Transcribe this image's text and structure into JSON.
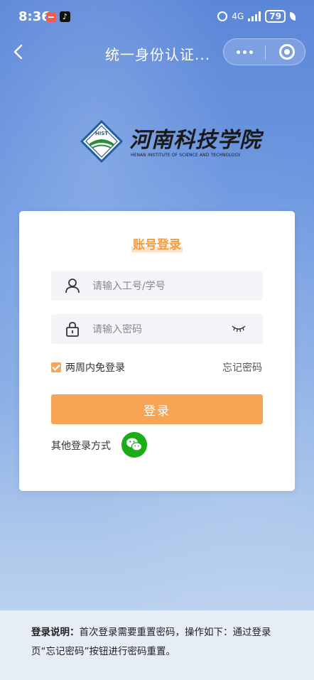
{
  "status_bar": {
    "time": "8:36",
    "network": "4G",
    "battery": "79"
  },
  "nav": {
    "title": "统一身份认证..."
  },
  "logo": {
    "name_cn": "河南科技学院",
    "name_en": "HENAN INSTITUTE OF SCIENCE AND TECHNOLOGY",
    "emblem_text": "HIST"
  },
  "login": {
    "title": "账号登录",
    "username_placeholder": "请输入工号/学号",
    "password_placeholder": "请输入密码",
    "remember_label": "两周内免登录",
    "remember_checked": true,
    "forgot_label": "忘记密码",
    "submit_label": "登录",
    "other_methods_label": "其他登录方式"
  },
  "notice": {
    "label": "登录说明：",
    "text": "首次登录需要重置密码，操作如下：通过登录页“忘记密码”按钮进行密码重置。"
  },
  "colors": {
    "accent": "#f7a454",
    "wechat": "#1aad19"
  },
  "icons": [
    "back-icon",
    "more-icon",
    "close-mini-icon",
    "user-icon",
    "lock-icon",
    "eye-closed-icon",
    "wechat-icon"
  ]
}
